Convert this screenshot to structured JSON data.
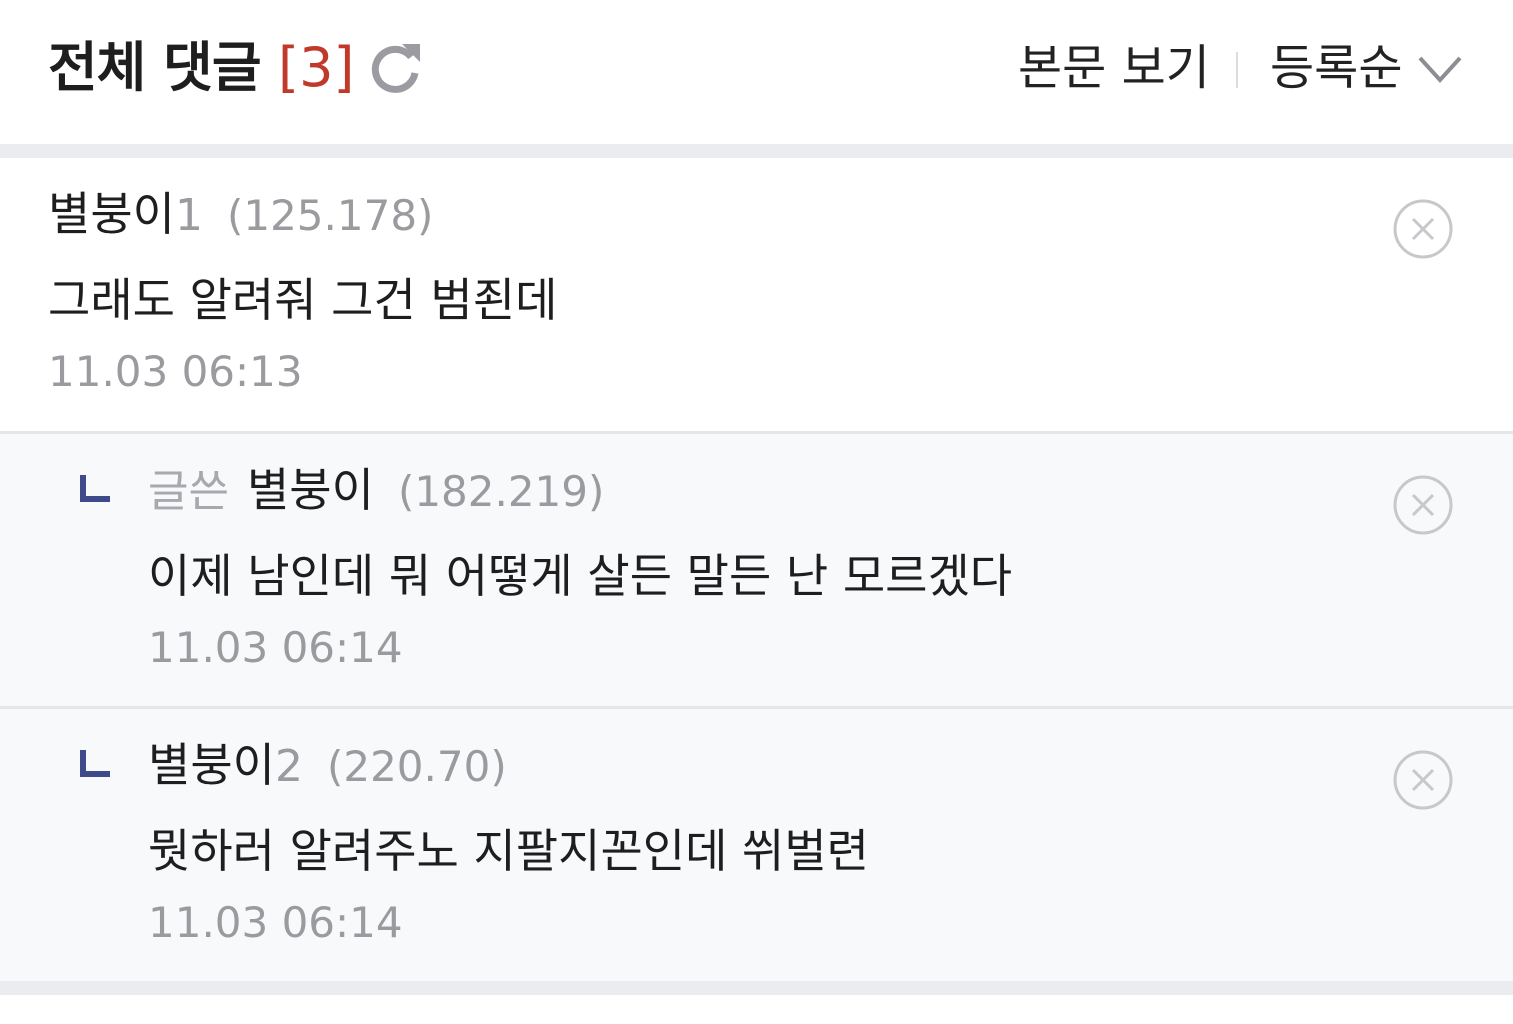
{
  "header": {
    "title": "전체 댓글",
    "count": "[3]",
    "refresh_icon": "refresh-icon",
    "view_body_label": "본문 보기",
    "sort_label": "등록순",
    "sort_icon": "chevron-down-icon"
  },
  "colors": {
    "count_accent": "#c0392b",
    "reply_marker": "#3f4a8a",
    "reply_background": "#f8f9fb",
    "separator": "#ebecf0"
  },
  "comments": [
    {
      "author": "별붕이",
      "author_suffix": "1",
      "ip": "(125.178)",
      "text": "그래도 알려줘 그건 범죈데",
      "time": "11.03 06:13",
      "is_reply": false
    },
    {
      "author_tag": "글쓴",
      "author": "별붕이",
      "ip": "(182.219)",
      "text": "이제 남인데 뭐 어떻게 살든 말든 난 모르겠다",
      "time": "11.03 06:14",
      "is_reply": true
    },
    {
      "author": "별붕이",
      "author_suffix": "2",
      "ip": "(220.70)",
      "text": "뭣하러 알려주노 지팔지꼰인데 쒸벌련",
      "time": "11.03 06:14",
      "is_reply": true
    }
  ]
}
